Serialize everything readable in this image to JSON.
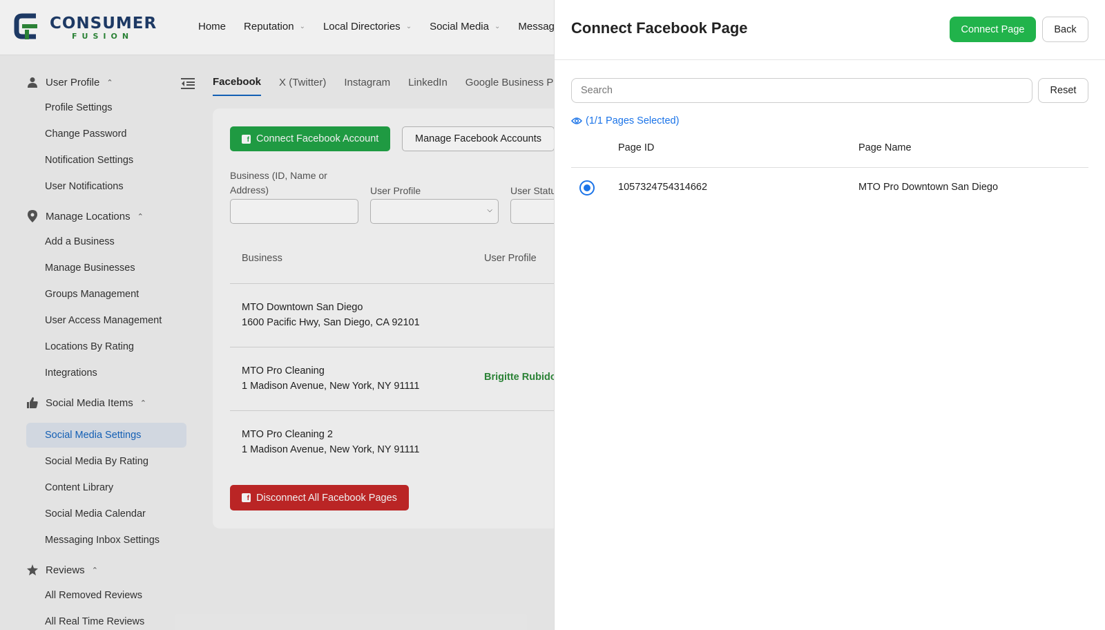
{
  "logo": {
    "word1": "CONSUMER",
    "word2": "FUSION"
  },
  "nav": [
    {
      "label": "Home",
      "dropdown": false
    },
    {
      "label": "Reputation",
      "dropdown": true
    },
    {
      "label": "Local Directories",
      "dropdown": true
    },
    {
      "label": "Social Media",
      "dropdown": true
    },
    {
      "label": "Messagi",
      "dropdown": false
    }
  ],
  "sidebar": {
    "user_profile": {
      "label": "User Profile",
      "items": [
        "Profile Settings",
        "Change Password",
        "Notification Settings",
        "User Notifications"
      ]
    },
    "manage_locations": {
      "label": "Manage Locations",
      "items": [
        "Add a Business",
        "Manage Businesses",
        "Groups Management",
        "User Access Management",
        "Locations By Rating",
        "Integrations"
      ]
    },
    "social_media_items": {
      "label": "Social Media Items",
      "items": [
        "Social Media Settings",
        "Social Media By Rating",
        "Content Library",
        "Social Media Calendar",
        "Messaging Inbox Settings"
      ],
      "active": "Social Media Settings"
    },
    "reviews": {
      "label": "Reviews",
      "items": [
        "All Removed Reviews",
        "All Real Time Reviews"
      ]
    }
  },
  "tabs": [
    "Facebook",
    "X (Twitter)",
    "Instagram",
    "LinkedIn",
    "Google Business Profi"
  ],
  "main": {
    "connect_account_label": "Connect Facebook Account",
    "manage_accounts_label": "Manage Facebook Accounts",
    "filter_business_label_line1": "Business (ID, Name or",
    "filter_business_label_line2": "Address)",
    "filter_user_profile_label": "User Profile",
    "filter_user_status_label": "User Statu",
    "table_headers": [
      "Business",
      "User Profile"
    ],
    "rows": [
      {
        "name": "MTO Downtown San Diego",
        "address": "1600 Pacific Hwy, San Diego, CA 92101",
        "user_profile": ""
      },
      {
        "name": "MTO Pro Cleaning",
        "address": "1 Madison Avenue, New York, NY 91111",
        "user_profile": "Brigitte Rubidou"
      },
      {
        "name": "MTO Pro Cleaning 2",
        "address": "1 Madison Avenue, New York, NY 91111",
        "user_profile": ""
      }
    ],
    "disconnect_label": "Disconnect All Facebook Pages"
  },
  "drawer": {
    "title": "Connect Facebook Page",
    "connect_label": "Connect Page",
    "back_label": "Back",
    "search_placeholder": "Search",
    "reset_label": "Reset",
    "selected_text": "(1/1 Pages Selected)",
    "headers": {
      "page_id": "Page ID",
      "page_name": "Page Name"
    },
    "rows": [
      {
        "page_id": "1057324754314662",
        "page_name": "MTO Pro Downtown San Diego",
        "selected": true
      }
    ]
  },
  "colors": {
    "green": "#21b34b",
    "blue": "#1a73e8",
    "red": "#c62828",
    "active_nav": "#1565c0"
  }
}
